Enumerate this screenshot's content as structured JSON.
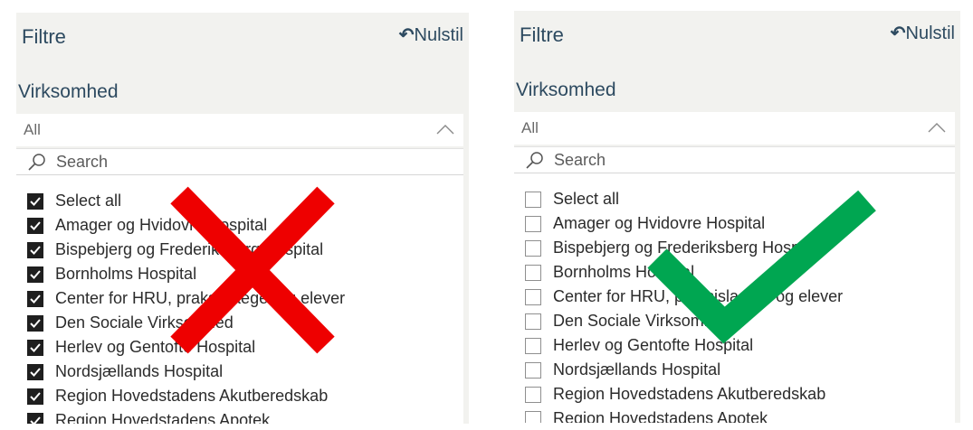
{
  "left_panel": {
    "title": "Filtre",
    "reset_label": "Nulstil",
    "section_label": "Virksomhed",
    "dropdown_value": "All",
    "search_placeholder": "Search",
    "items": [
      {
        "label": "Select all",
        "checked": true
      },
      {
        "label": "Amager og Hvidovre Hospital",
        "checked": true
      },
      {
        "label": "Bispebjerg og Frederiksberg Hospital",
        "checked": true
      },
      {
        "label": "Bornholms Hospital",
        "checked": true
      },
      {
        "label": "Center for HRU, praksislaeger og elever",
        "checked": true
      },
      {
        "label": "Den Sociale Virksomhed",
        "checked": true
      },
      {
        "label": "Herlev og Gentofte Hospital",
        "checked": true
      },
      {
        "label": "Nordsjællands Hospital",
        "checked": true
      },
      {
        "label": "Region Hovedstadens Akutberedskab",
        "checked": true
      },
      {
        "label": "Region Hovedstadens Apotek",
        "checked": true
      }
    ],
    "overlay_mark": "red-cross",
    "overlay_color": "#ee0000"
  },
  "right_panel": {
    "title": "Filtre",
    "reset_label": "Nulstil",
    "section_label": "Virksomhed",
    "dropdown_value": "All",
    "search_placeholder": "Search",
    "items": [
      {
        "label": "Select all",
        "checked": false
      },
      {
        "label": "Amager og Hvidovre Hospital",
        "checked": false
      },
      {
        "label": "Bispebjerg og Frederiksberg Hospital",
        "checked": false
      },
      {
        "label": "Bornholms Hospital",
        "checked": false
      },
      {
        "label": "Center for HRU, praksislaeger og elever",
        "checked": false
      },
      {
        "label": "Den Sociale Virksomhed",
        "checked": false
      },
      {
        "label": "Herlev og Gentofte Hospital",
        "checked": false
      },
      {
        "label": "Nordsjællands Hospital",
        "checked": false
      },
      {
        "label": "Region Hovedstadens Akutberedskab",
        "checked": false
      },
      {
        "label": "Region Hovedstadens Apotek",
        "checked": false
      }
    ],
    "overlay_mark": "green-checkmark",
    "overlay_color": "#00a651"
  }
}
